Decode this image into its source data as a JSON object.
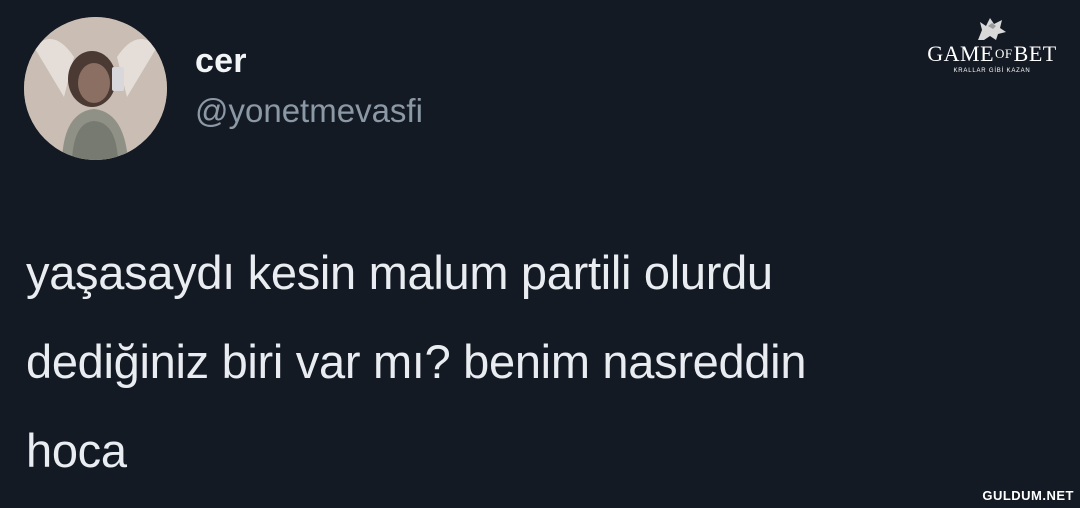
{
  "tweet": {
    "display_name": "cer",
    "handle": "@yonetmevasfi",
    "text_lines": [
      "yaşasaydı kesin malum partili olurdu",
      "dediğiniz biri var mı? benim nasreddin",
      "hoca"
    ],
    "avatar_icon": "profile-photo"
  },
  "overlay": {
    "logo_title_left": "GAME",
    "logo_title_mid": "OF",
    "logo_title_right": "BET",
    "logo_subtitle": "KRALLAR GİBİ KAZAN",
    "logo_icon": "wolf-icon",
    "watermark": "GULDUM.NET"
  },
  "colors": {
    "background": "#141a24",
    "text": "#e9edf1",
    "handle": "#8b98a5"
  }
}
